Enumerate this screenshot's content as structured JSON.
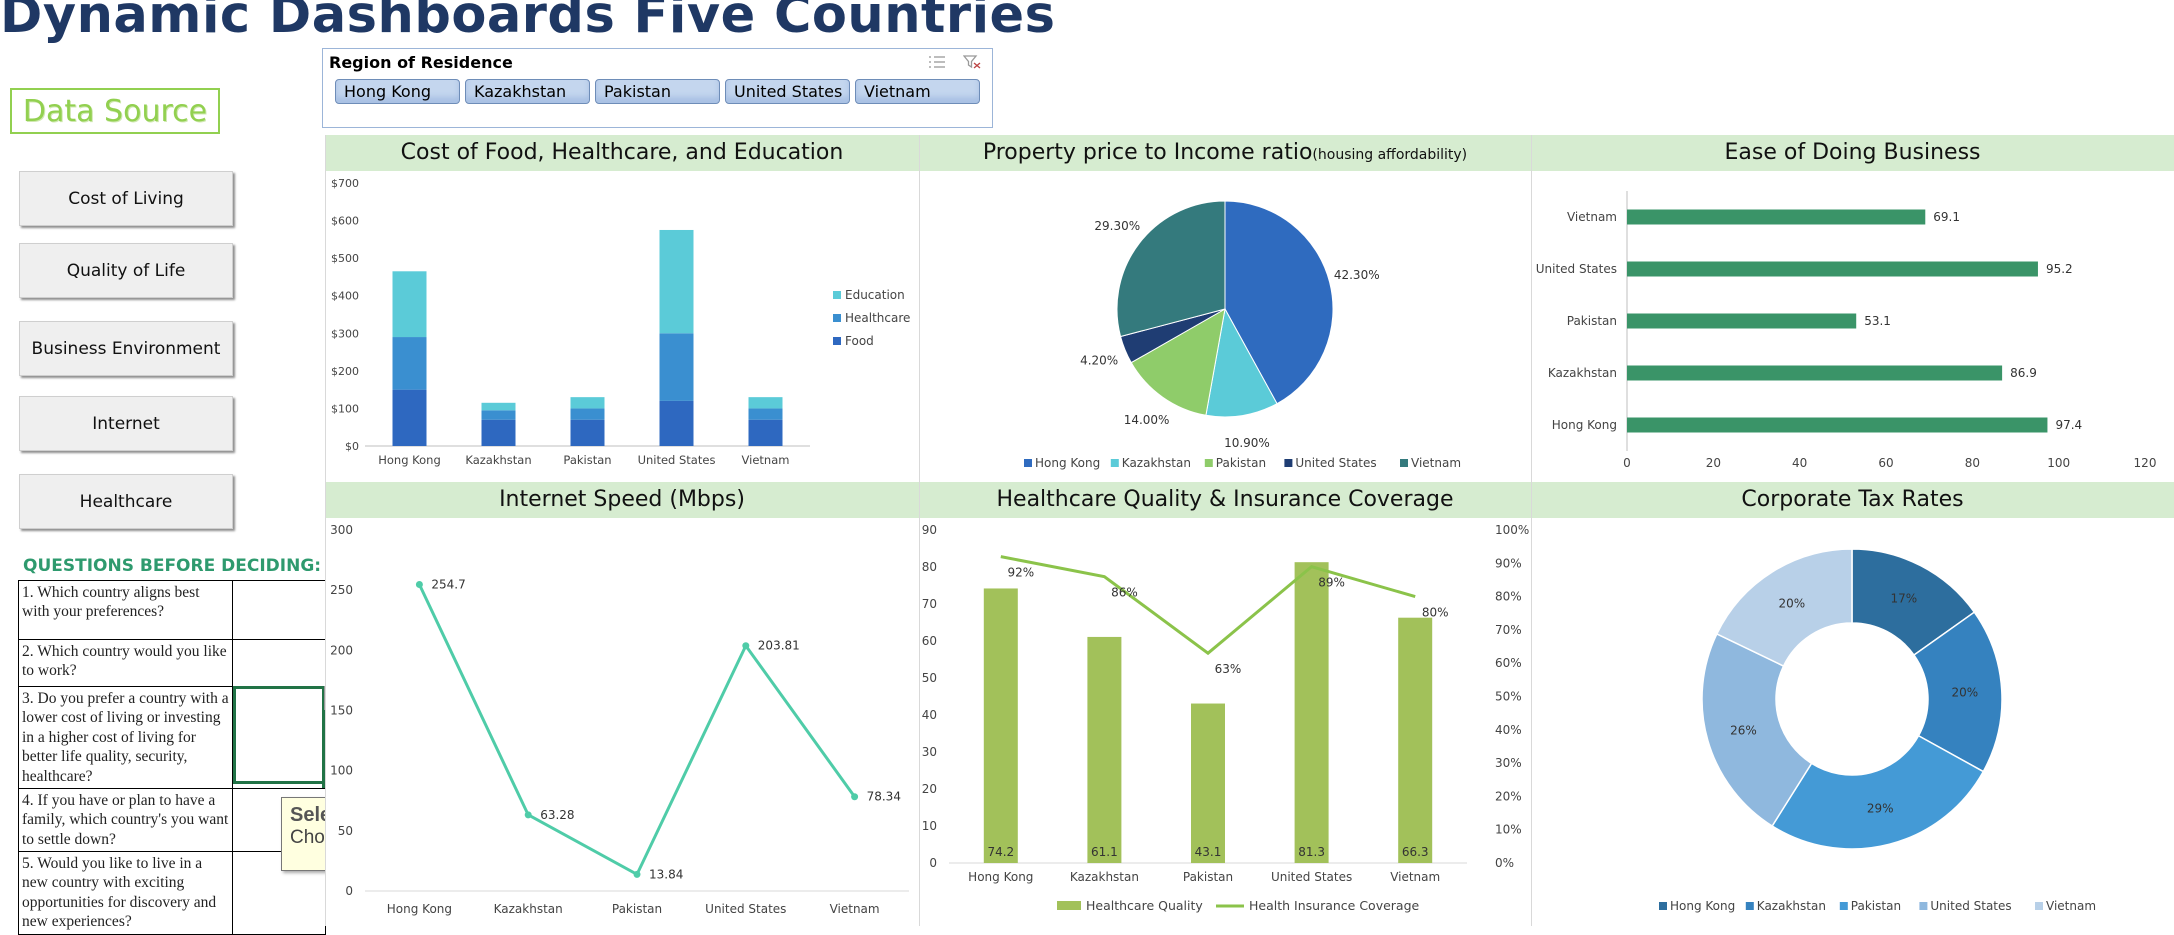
{
  "page_title": "Dynamic Dashboards Five Countries",
  "data_source_label": "Data Source",
  "nav_buttons": [
    "Cost of Living",
    "Quality of Life",
    "Business Environment",
    "Internet",
    "Healthcare"
  ],
  "questions": {
    "heading": "QUESTIONS BEFORE DECIDING:",
    "items": [
      "1. Which country aligns best with your preferences?",
      "2. Which country would you like to work?",
      "3. Do you prefer a country with a lower cost of living or investing in a higher cost of living for better life quality, security, healthcare?",
      "4. If you have or plan to have a family, which country's you want to settle down?",
      "5. Would you like to live in a new country with exciting opportunities for discovery and new experiences?"
    ]
  },
  "tooltip": {
    "title": "Selection",
    "text": "Choose your answer"
  },
  "slicer": {
    "header": "Region of Residence",
    "items": [
      "Hong Kong",
      "Kazakhstan",
      "Pakistan",
      "United States",
      "Vietnam"
    ],
    "multiselect_icon": "multi-select-icon",
    "clear_icon": "clear-filter-icon"
  },
  "colors": {
    "title": "#1f3864",
    "panel_header": "#d6ecd0",
    "food": "#2e68c0",
    "healthcare": "#3a8fd0",
    "education": "#5bcbd8",
    "hong_kong": "#2f6bbf",
    "kazakhstan": "#5bcbd8",
    "pakistan": "#8fcc6a",
    "united_states": "#1f3d73",
    "vietnam": "#347a7d",
    "business_bar": "#3a9468",
    "internet_line": "#4fcca8",
    "health_bar": "#a2c15a",
    "health_line": "#8bc34a",
    "tax_hk": "#2d6e9e",
    "tax_kz": "#3582bf",
    "tax_pk": "#449ad6",
    "tax_us": "#8fb8de",
    "tax_vn": "#b8d0e8"
  },
  "chart_data": [
    {
      "type": "bar",
      "stacked": true,
      "title": "Cost of Food, Healthcare, and Education",
      "categories": [
        "Hong Kong",
        "Kazakhstan",
        "Pakistan",
        "United States",
        "Vietnam"
      ],
      "series": [
        {
          "name": "Food",
          "values": [
            150,
            70,
            70,
            120,
            70
          ]
        },
        {
          "name": "Healthcare",
          "values": [
            140,
            25,
            30,
            180,
            30
          ]
        },
        {
          "name": "Education",
          "values": [
            175,
            20,
            30,
            275,
            30
          ]
        }
      ],
      "ylim": [
        0,
        700
      ],
      "yticks": [
        "$0",
        "$100",
        "$200",
        "$300",
        "$400",
        "$500",
        "$600",
        "$700"
      ],
      "legend": "right"
    },
    {
      "type": "pie",
      "title": "Property price to Income ratio",
      "subtitle": "(housing affordability)",
      "categories": [
        "Hong Kong",
        "Kazakhstan",
        "Pakistan",
        "United States",
        "Vietnam"
      ],
      "values": [
        42.3,
        10.9,
        14.0,
        4.2,
        29.3
      ],
      "labels": [
        "42.30%",
        "10.90%",
        "14.00%",
        "4.20%",
        "29.30%"
      ],
      "legend": "bottom"
    },
    {
      "type": "bar",
      "orientation": "horizontal",
      "title": "Ease of Doing Business",
      "categories": [
        "Hong Kong",
        "Kazakhstan",
        "Pakistan",
        "United States",
        "Vietnam"
      ],
      "values": [
        97.4,
        86.9,
        53.1,
        95.2,
        69.1
      ],
      "xlim": [
        0,
        120
      ],
      "xticks": [
        "0",
        "20",
        "40",
        "60",
        "80",
        "100",
        "120"
      ]
    },
    {
      "type": "line",
      "title": "Internet Speed (Mbps)",
      "categories": [
        "Hong Kong",
        "Kazakhstan",
        "Pakistan",
        "United States",
        "Vietnam"
      ],
      "values": [
        254.7,
        63.28,
        13.84,
        203.81,
        78.34
      ],
      "ylim": [
        0,
        300
      ],
      "yticks": [
        "0",
        "50",
        "100",
        "150",
        "200",
        "250",
        "300"
      ]
    },
    {
      "type": "bar",
      "title": "Healthcare Quality & Insurance Coverage",
      "categories": [
        "Hong Kong",
        "Kazakhstan",
        "Pakistan",
        "United States",
        "Vietnam"
      ],
      "series": [
        {
          "name": "Healthcare Quality",
          "type": "bar",
          "values": [
            74.2,
            61.1,
            43.1,
            81.3,
            66.3
          ]
        },
        {
          "name": "Health Insurance Coverage",
          "type": "line",
          "values": [
            92,
            86,
            63,
            89,
            80
          ],
          "labels": [
            "92%",
            "86%",
            "63%",
            "89%",
            "80%"
          ]
        }
      ],
      "ylim": [
        0,
        90
      ],
      "yticks": [
        "0",
        "10",
        "20",
        "30",
        "40",
        "50",
        "60",
        "70",
        "80",
        "90"
      ],
      "y2lim": [
        0,
        100
      ],
      "y2ticks": [
        "0%",
        "10%",
        "20%",
        "30%",
        "40%",
        "50%",
        "60%",
        "70%",
        "80%",
        "90%",
        "100%"
      ],
      "legend": "bottom"
    },
    {
      "type": "pie",
      "donut": true,
      "title": "Corporate Tax Rates",
      "categories": [
        "Hong Kong",
        "Kazakhstan",
        "Pakistan",
        "United States",
        "Vietnam"
      ],
      "values": [
        17,
        20,
        29,
        26,
        20
      ],
      "labels": [
        "17%",
        "20%",
        "29%",
        "26%",
        "20%"
      ],
      "legend": "bottom"
    }
  ]
}
